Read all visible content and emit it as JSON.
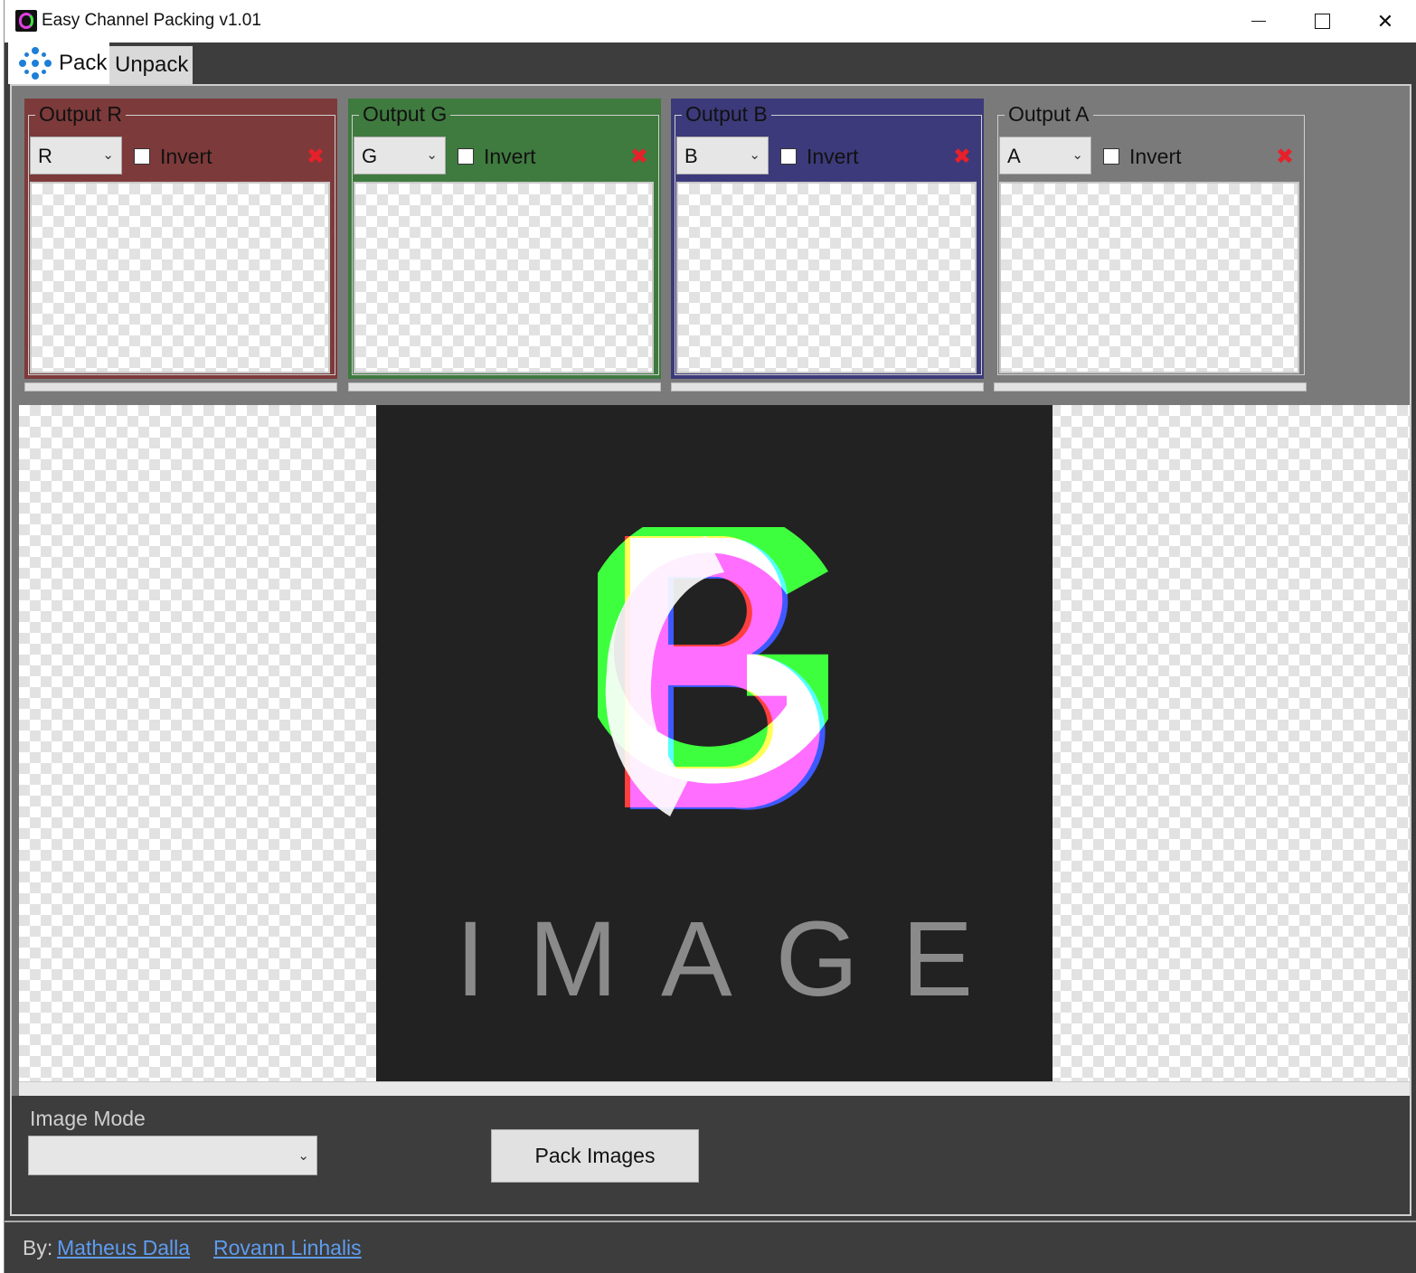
{
  "window": {
    "title": "Easy Channel Packing v1.01",
    "minimize_icon": "minimize-icon",
    "maximize_icon": "maximize-icon",
    "close_glyph": "✕"
  },
  "tabs": [
    {
      "label": "Pack",
      "icon": "pack-icon",
      "selected": true
    },
    {
      "label": "Unpack",
      "selected": false
    }
  ],
  "outputs": [
    {
      "legend": "Output R",
      "channel": "R",
      "invert_label": "Invert",
      "invert_checked": false,
      "color": "#7d3a3a",
      "remove_glyph": "✖"
    },
    {
      "legend": "Output G",
      "channel": "G",
      "invert_label": "Invert",
      "invert_checked": false,
      "color": "#3f7a3f",
      "remove_glyph": "✖"
    },
    {
      "legend": "Output B",
      "channel": "B",
      "invert_label": "Invert",
      "invert_checked": false,
      "color": "#3c3a7a",
      "remove_glyph": "✖"
    },
    {
      "legend": "Output A",
      "channel": "A",
      "invert_label": "Invert",
      "invert_checked": false,
      "color": "#7a7a7a",
      "remove_glyph": "✖"
    }
  ],
  "preview": {
    "image_text": "IMAGE",
    "background": "#222222"
  },
  "controls": {
    "image_mode_label": "Image Mode",
    "image_mode_value": "",
    "pack_button": "Pack Images"
  },
  "footer": {
    "by_label": "By:",
    "authors": [
      "Matheus Dalla",
      "Rovann Linhalis"
    ]
  },
  "icons": {
    "dropdown": "chevron-down-icon",
    "remove": "close-red-icon"
  },
  "colors": {
    "link": "#5e9cf0",
    "remove": "#e8202a",
    "accent": "#1e7fd8"
  }
}
